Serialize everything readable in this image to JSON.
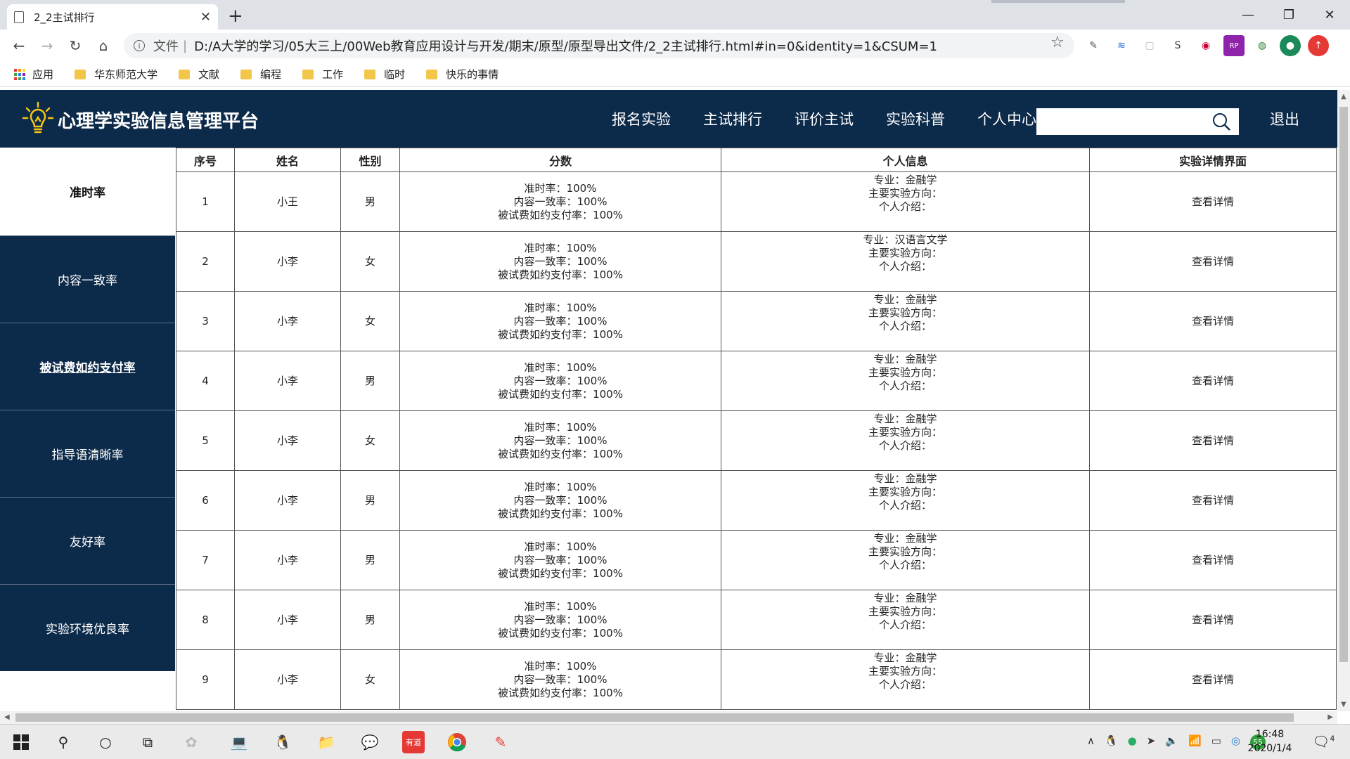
{
  "browser": {
    "tab_title": "2_2主试排行",
    "tab_close": "✕",
    "new_tab": "+",
    "address_prefix": "文件",
    "address_separator": "|",
    "url": "D:/A大学的学习/05大三上/00Web教育应用设计与开发/期末/原型/原型导出文件/2_2主试排行.html#in=0&identity=1&CSUM=1",
    "bookmarks": [
      {
        "label": "应用"
      },
      {
        "label": "华东师范大学"
      },
      {
        "label": "文献"
      },
      {
        "label": "编程"
      },
      {
        "label": "工作"
      },
      {
        "label": "临时"
      },
      {
        "label": "快乐的事情"
      }
    ]
  },
  "site": {
    "title": "心理学实验信息管理平台",
    "nav": [
      "报名实验",
      "主试排行",
      "评价主试",
      "实验科普",
      "个人中心"
    ],
    "search": {
      "value": "",
      "placeholder": ""
    },
    "logout": "退出"
  },
  "sidebar": {
    "items": [
      {
        "label": "准时率",
        "state": "active"
      },
      {
        "label": "内容一致率",
        "state": "normal"
      },
      {
        "label": "被试费如约支付率",
        "state": "highlight"
      },
      {
        "label": "指导语清晰率",
        "state": "normal"
      },
      {
        "label": "友好率",
        "state": "normal"
      },
      {
        "label": "实验环境优良率",
        "state": "normal"
      }
    ]
  },
  "table": {
    "headers": [
      "序号",
      "姓名",
      "性别",
      "分数",
      "个人信息",
      "实验详情界面"
    ],
    "score_labels": {
      "on_time": "准时率：",
      "consistency": "内容一致率：",
      "payment": "被试费如约支付率："
    },
    "info_labels": {
      "major": "专业：",
      "direction": "主要实验方向：",
      "intro": "个人介绍："
    },
    "detail_label": "查看详情",
    "rows": [
      {
        "no": "1",
        "name": "小王",
        "gender": "男",
        "on_time": "100%",
        "consistency": "100%",
        "payment": "100%",
        "major": "金融学"
      },
      {
        "no": "2",
        "name": "小李",
        "gender": "女",
        "on_time": "100%",
        "consistency": "100%",
        "payment": "100%",
        "major": "汉语言文学"
      },
      {
        "no": "3",
        "name": "小李",
        "gender": "女",
        "on_time": "100%",
        "consistency": "100%",
        "payment": "100%",
        "major": "金融学"
      },
      {
        "no": "4",
        "name": "小李",
        "gender": "男",
        "on_time": "100%",
        "consistency": "100%",
        "payment": "100%",
        "major": "金融学"
      },
      {
        "no": "5",
        "name": "小李",
        "gender": "女",
        "on_time": "100%",
        "consistency": "100%",
        "payment": "100%",
        "major": "金融学"
      },
      {
        "no": "6",
        "name": "小李",
        "gender": "男",
        "on_time": "100%",
        "consistency": "100%",
        "payment": "100%",
        "major": "金融学"
      },
      {
        "no": "7",
        "name": "小李",
        "gender": "男",
        "on_time": "100%",
        "consistency": "100%",
        "payment": "100%",
        "major": "金融学"
      },
      {
        "no": "8",
        "name": "小李",
        "gender": "男",
        "on_time": "100%",
        "consistency": "100%",
        "payment": "100%",
        "major": "金融学"
      },
      {
        "no": "9",
        "name": "小李",
        "gender": "女",
        "on_time": "100%",
        "consistency": "100%",
        "payment": "100%",
        "major": "金融学"
      }
    ]
  },
  "taskbar": {
    "time": "16:48",
    "date": "2020/1/4",
    "notification_count": "4",
    "tray_badge": "55"
  },
  "colors": {
    "header_bg": "#0c2a4a",
    "sidebar_dark": "#0c2a4a",
    "folder": "#f2c648",
    "logo": "#f5c518"
  },
  "icons": {
    "logo": "lightbulb-icon",
    "search": "search-icon",
    "bookmark_folder": "folder-icon"
  }
}
